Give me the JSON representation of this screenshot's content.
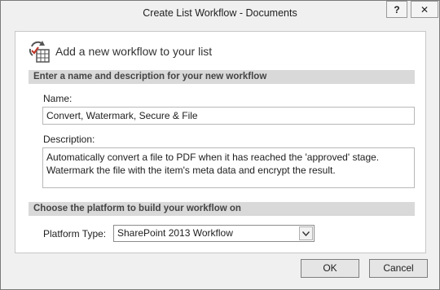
{
  "window": {
    "title": "Create List Workflow - Documents",
    "help_glyph": "?",
    "close_glyph": "✕"
  },
  "header": {
    "title": "Add a new workflow to your list",
    "icon": "workflow-icon"
  },
  "section_name": {
    "heading": "Enter a name and description for your new workflow",
    "name_label": "Name:",
    "name_value": "Convert, Watermark, Secure & File",
    "description_label": "Description:",
    "description_value": "Automatically convert a file to PDF when it has reached the 'approved' stage.\nWatermark the file with the item's meta data and encrypt the result."
  },
  "section_platform": {
    "heading": "Choose the platform to build your workflow on",
    "platform_label": "Platform Type:",
    "platform_value": "SharePoint 2013 Workflow"
  },
  "buttons": {
    "ok": "OK",
    "cancel": "Cancel"
  }
}
